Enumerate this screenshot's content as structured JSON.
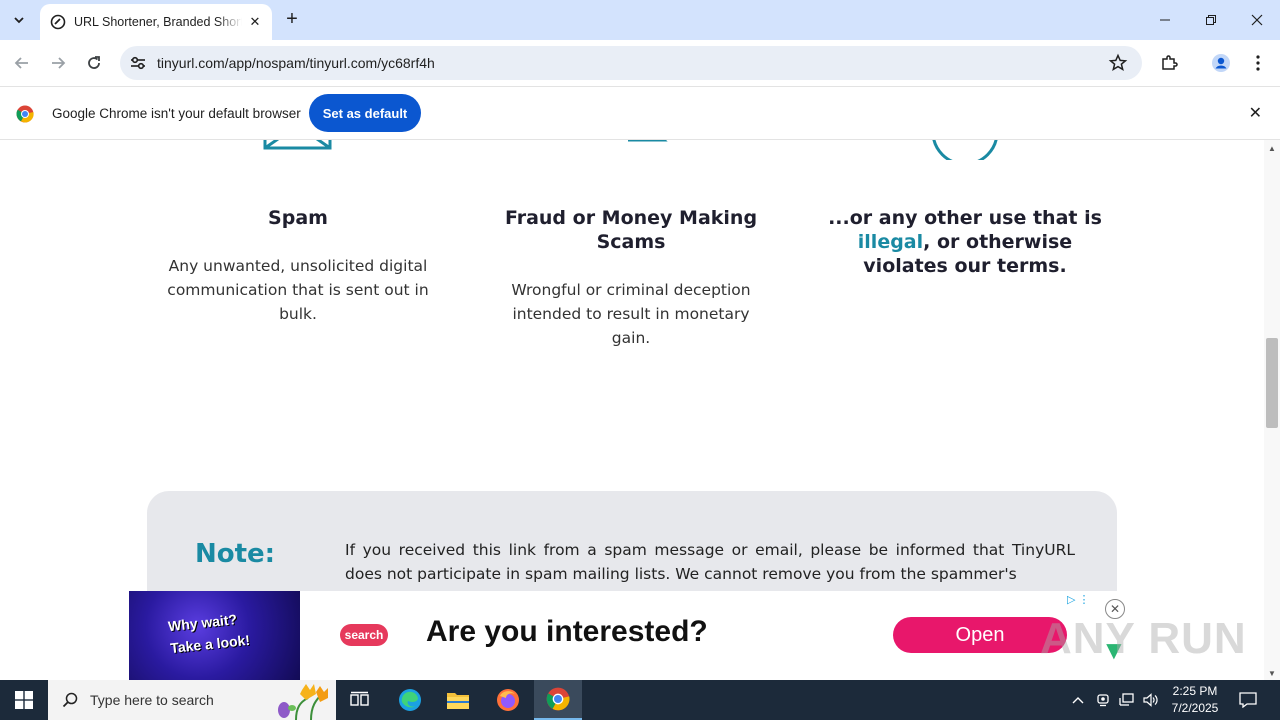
{
  "browser": {
    "tab_title": "URL Shortener, Branded Short Links & Analytics | TinyURL",
    "url": "tinyurl.com/app/nospam/tinyurl.com/yc68rf4h",
    "infobar_message": "Google Chrome isn't your default browser",
    "set_default_label": "Set as default"
  },
  "page": {
    "columns": [
      {
        "heading": "Spam",
        "body": "Any unwanted, unsolicited digital communication that is sent out in bulk."
      },
      {
        "heading": "Fraud or Money Making Scams",
        "body": "Wrongful or criminal deception intended to result in monetary gain."
      },
      {
        "heading_prefix": "...or any other use that is ",
        "heading_link": "illegal",
        "heading_suffix": ", or otherwise violates our terms."
      }
    ],
    "note": {
      "label": "Note:",
      "text": "If you received this link from a spam message or email, please be informed that TinyURL does not participate in spam mailing lists. We cannot remove you from the spammer's"
    }
  },
  "ad": {
    "image_text_line1": "Why wait?",
    "image_text_line2": "Take a look!",
    "brand": "search",
    "headline": "Are you interested?",
    "cta": "Open"
  },
  "watermark": "ANY RUN",
  "taskbar": {
    "search_placeholder": "Type here to search",
    "time": "2:25 PM",
    "date": "7/2/2025"
  },
  "colors": {
    "accent_teal": "#1a8aa3",
    "chrome_blue": "#0b57d0",
    "ad_pink": "#e8176b"
  }
}
